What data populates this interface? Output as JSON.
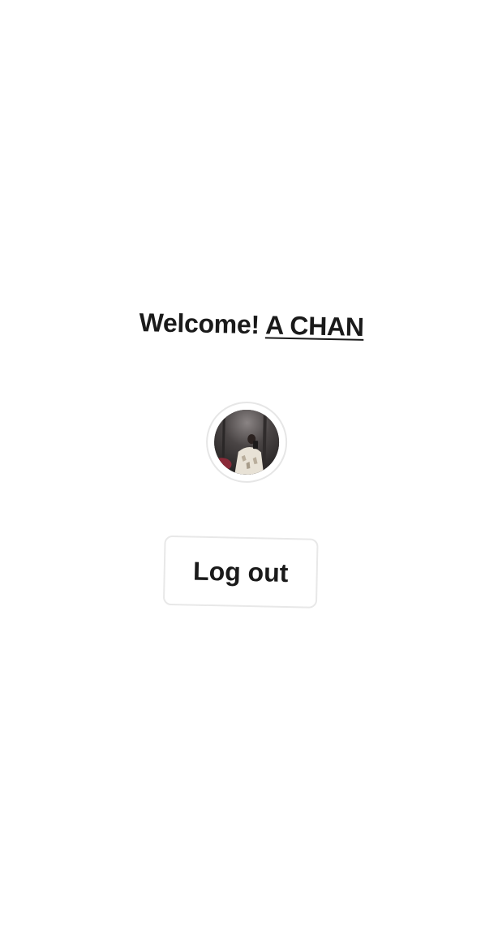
{
  "header": {
    "welcome_text": "Welcome!",
    "username": "A CHAN"
  },
  "profile": {
    "avatar_icon": "user-photo"
  },
  "actions": {
    "logout_label": "Log out"
  },
  "colors": {
    "background": "#ffffff",
    "text": "#1a1a1a",
    "border": "#e8e8e8"
  }
}
